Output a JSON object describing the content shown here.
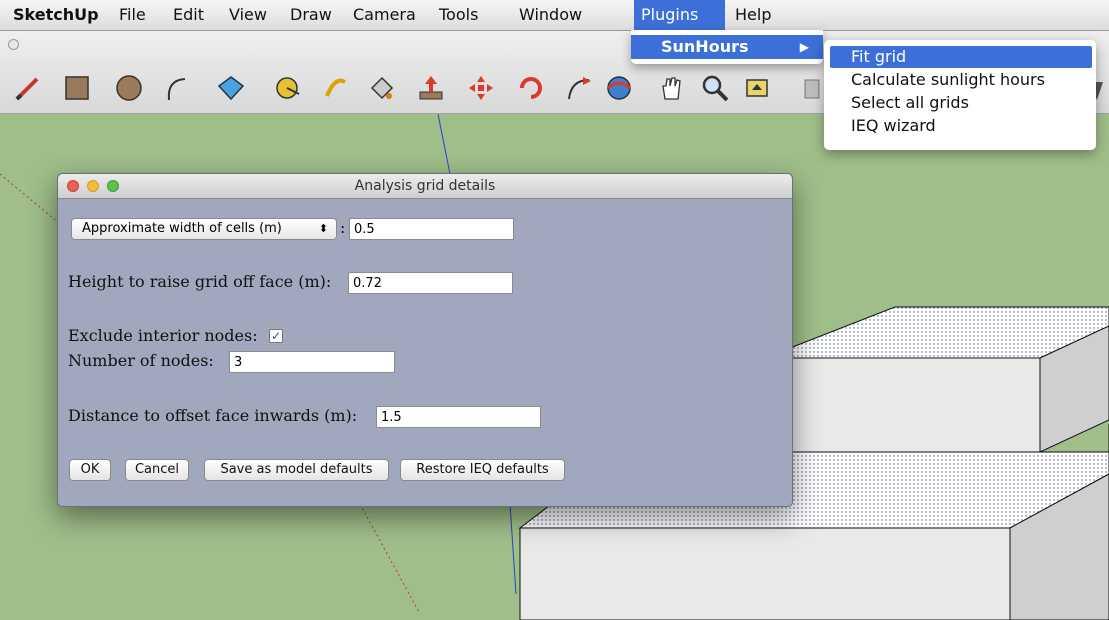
{
  "menubar": {
    "app": "SketchUp",
    "items": [
      "File",
      "Edit",
      "View",
      "Draw",
      "Camera",
      "Tools",
      "Window",
      "Plugins",
      "Help"
    ],
    "active": "Plugins"
  },
  "plugins_menu": {
    "items": [
      {
        "label": "SunHours",
        "has_submenu": true,
        "highlighted": true
      }
    ]
  },
  "sunhours_submenu": {
    "items": [
      {
        "label": "Fit grid",
        "highlighted": true
      },
      {
        "label": "Calculate sunlight hours"
      },
      {
        "label": "Select all grids"
      },
      {
        "label": "IEQ wizard"
      }
    ]
  },
  "toolbar": {
    "tools": [
      "pencil-icon",
      "rectangle-icon",
      "circle-icon",
      "arc-icon",
      "make-component-icon",
      "tape-measure-icon",
      "text-icon",
      "paint-bucket-icon",
      "push-pull-icon",
      "move-icon",
      "rotate-icon",
      "follow-me-icon",
      "orbit-icon",
      "pan-icon",
      "zoom-icon",
      "zoom-extents-icon"
    ]
  },
  "dialog": {
    "title": "Analysis grid details",
    "cell_mode": "Approximate width of cells (m)",
    "colon": ":",
    "cell_value": "0.5",
    "height_label": "Height to raise grid off face (m):",
    "height_value": "0.72",
    "exclude_label": "Exclude interior nodes:",
    "exclude_checked": true,
    "nodes_label": "Number of nodes:",
    "nodes_value": "3",
    "offset_label": "Distance to offset face inwards (m):",
    "offset_value": "1.5",
    "buttons": {
      "ok": "OK",
      "cancel": "Cancel",
      "save_defaults": "Save as model defaults",
      "restore_defaults": "Restore IEQ defaults"
    }
  },
  "colors": {
    "menu_highlight": "#3d6fd8",
    "viewport_bg": "#9fbe8a",
    "dialog_bg": "#a1a8bd"
  }
}
